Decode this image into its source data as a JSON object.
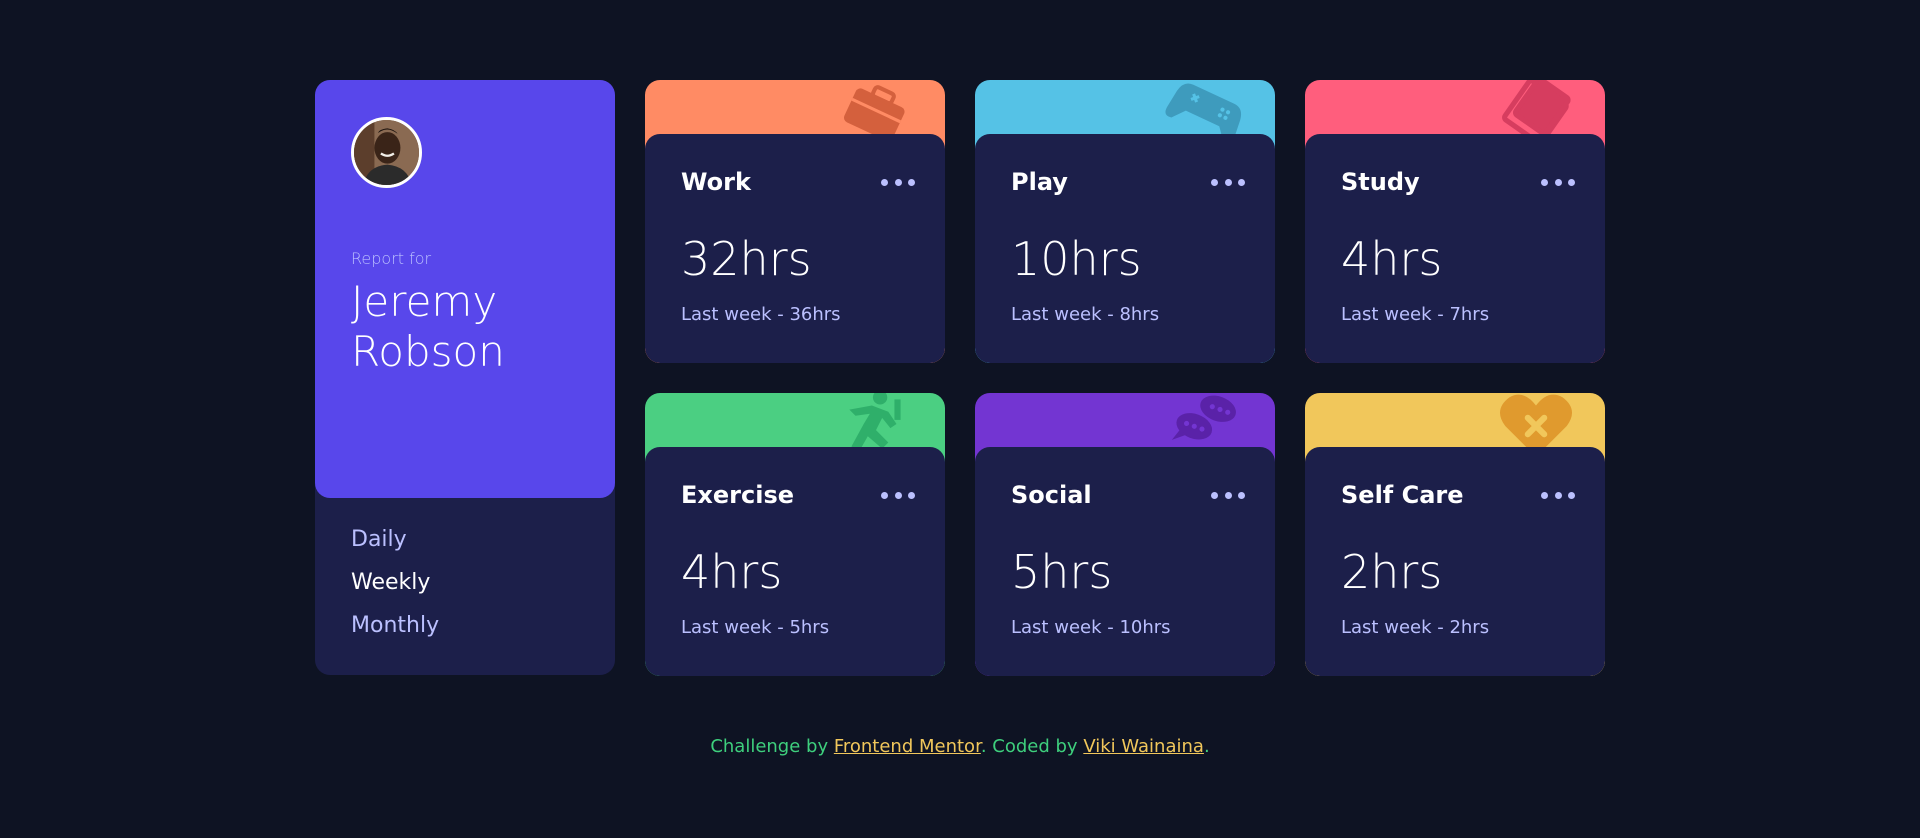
{
  "profile": {
    "report_for": "Report for",
    "name": "Jeremy Robson",
    "periods": [
      "Daily",
      "Weekly",
      "Monthly"
    ],
    "active_period": "Weekly"
  },
  "activities": [
    {
      "title": "Work",
      "hours": "32hrs",
      "previous": "Last week - 36hrs",
      "color": "#ff8b64",
      "icon": "briefcase-icon"
    },
    {
      "title": "Play",
      "hours": "10hrs",
      "previous": "Last week - 8hrs",
      "color": "#55c2e6",
      "icon": "gamepad-icon"
    },
    {
      "title": "Study",
      "hours": "4hrs",
      "previous": "Last week - 7hrs",
      "color": "#ff5e7d",
      "icon": "book-icon"
    },
    {
      "title": "Exercise",
      "hours": "4hrs",
      "previous": "Last week - 5hrs",
      "color": "#4bcf82",
      "icon": "running-icon"
    },
    {
      "title": "Social",
      "hours": "5hrs",
      "previous": "Last week - 10hrs",
      "color": "#7335d2",
      "icon": "chat-icon"
    },
    {
      "title": "Self Care",
      "hours": "2hrs",
      "previous": "Last week - 2hrs",
      "color": "#f1c75b",
      "icon": "heart-icon"
    }
  ],
  "footer": {
    "prefix": "Challenge by ",
    "link1": "Frontend Mentor",
    "middle": ". Coded by ",
    "link2": "Viki Wainaina",
    "suffix": "."
  }
}
